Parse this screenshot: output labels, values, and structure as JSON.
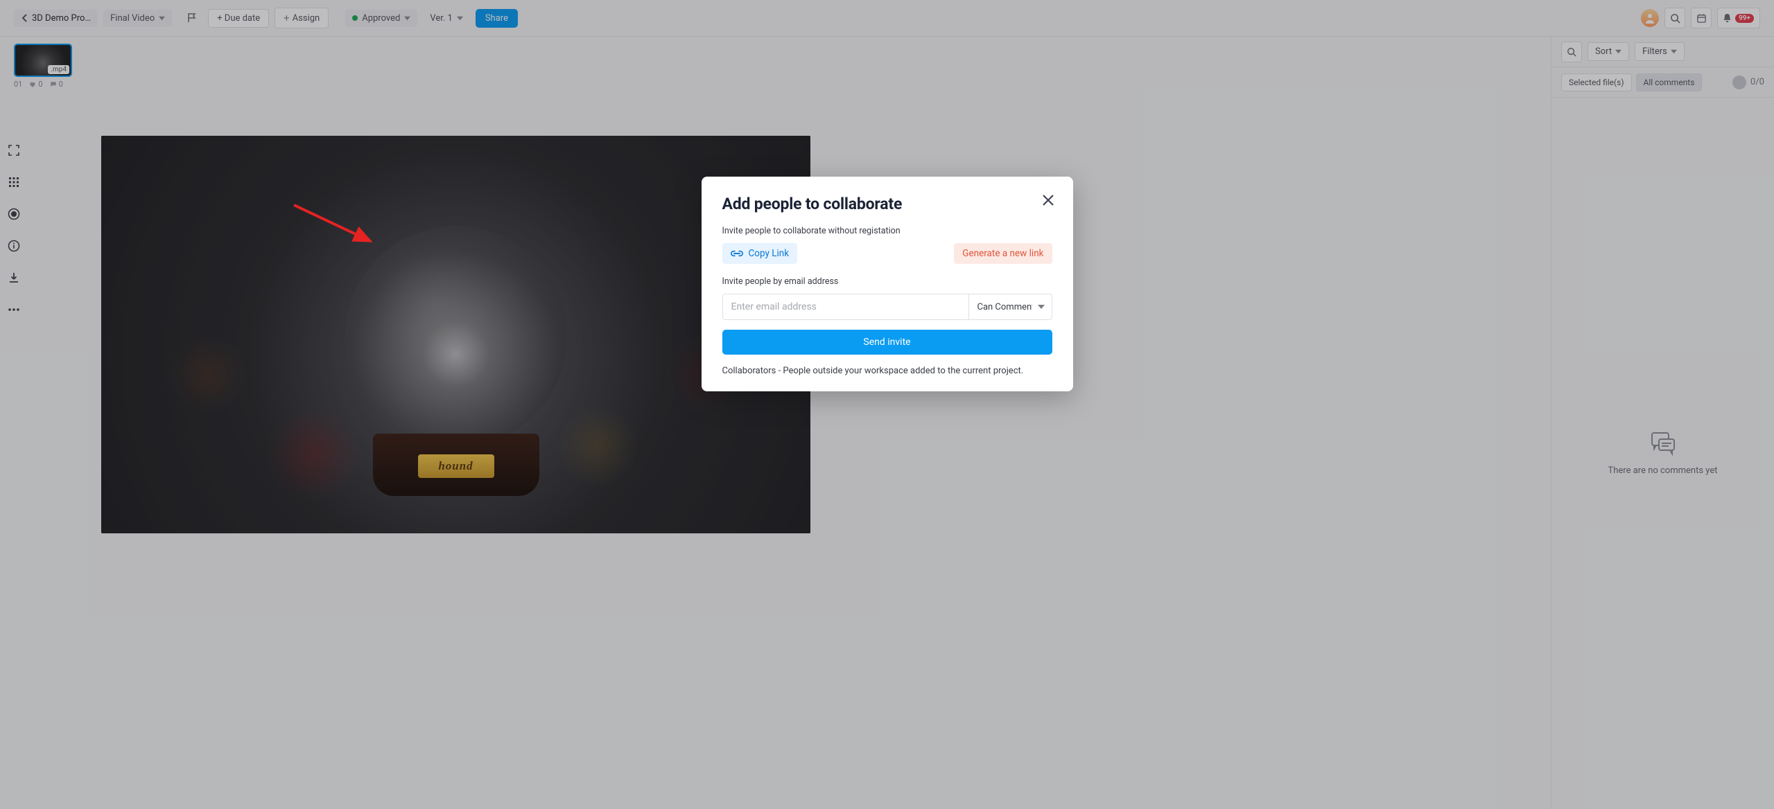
{
  "topbar": {
    "project_name": "3D Demo Pro…",
    "file_name": "Final Video",
    "due_date_label": "+ Due date",
    "assign_label": "Assign",
    "status_label": "Approved",
    "version_label": "Ver. 1",
    "share_label": "Share",
    "notif_badge": "99+"
  },
  "thumb": {
    "index": "01",
    "ext": ".mp4",
    "likes": "0",
    "comments": "0"
  },
  "right_panel": {
    "sort_label": "Sort",
    "filters_label": "Filters",
    "tab_selected": "Selected file(s)",
    "tab_all": "All comments",
    "count": "0/0",
    "empty_text": "There are no comments yet"
  },
  "viewer": {
    "plaque_text": "hound"
  },
  "modal": {
    "title": "Add people to collaborate",
    "label_link": "Invite people to collaborate without registation",
    "copy_link": "Copy Link",
    "generate_link": "Generate a new link",
    "label_email": "Invite people by email address",
    "email_placeholder": "Enter email address",
    "permission": "Can Comment",
    "send_label": "Send invite",
    "collab_note": "Collaborators - People outside your workspace added to the current project."
  }
}
